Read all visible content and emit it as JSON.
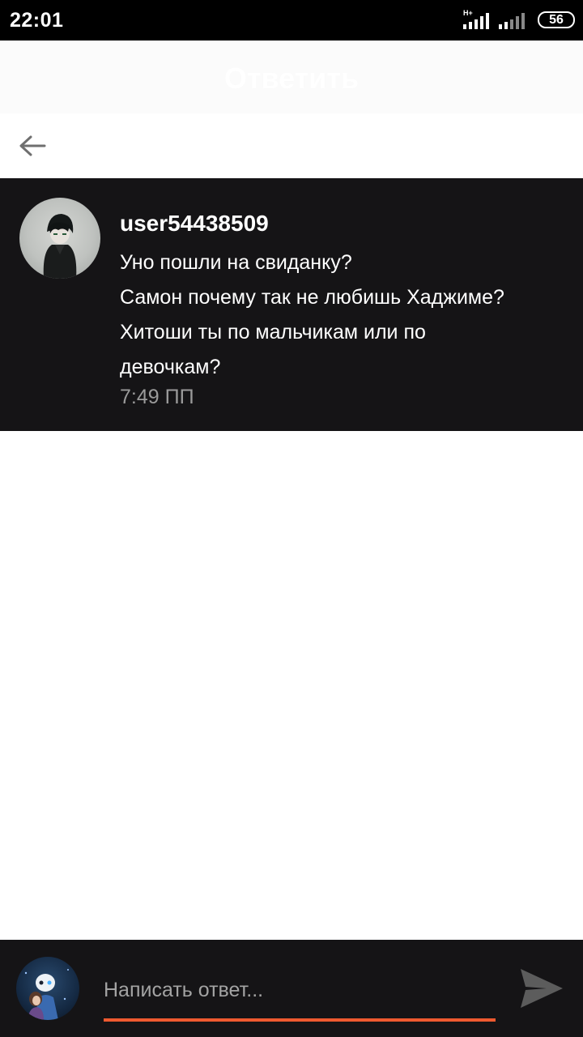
{
  "status_bar": {
    "time": "22:01",
    "network": "H+",
    "battery": "56"
  },
  "header": {
    "title": "Ответить"
  },
  "comment": {
    "username": "user54438509",
    "lines": [
      "Уно пошли на свиданку?",
      "Самон почему так не любишь Хаджиме?",
      "Хитоши ты по мальчикам или по",
      "девочкам?"
    ],
    "time": "7:49 ПП"
  },
  "reply": {
    "placeholder": "Написать ответ..."
  },
  "colors": {
    "accent": "#ee5a30",
    "dark_bg": "#151416",
    "meta_text": "#9a9a9a"
  },
  "icons": {
    "back": "arrow-left-icon",
    "send": "send-icon",
    "signal": "signal-icon",
    "battery": "battery-icon"
  }
}
